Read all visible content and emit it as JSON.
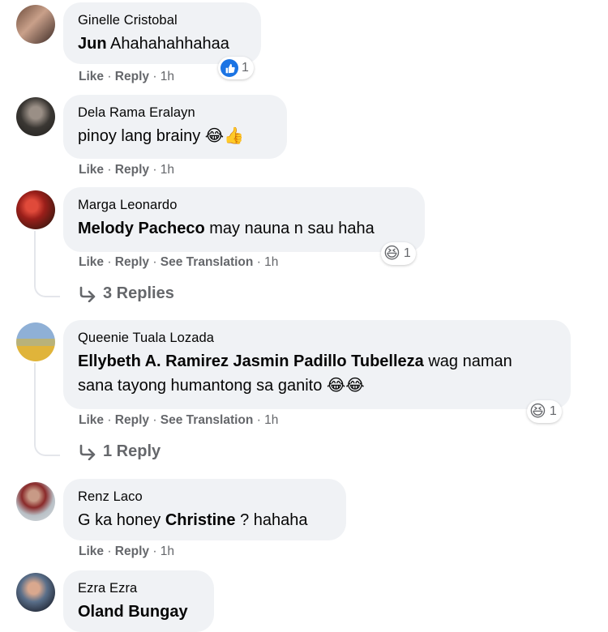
{
  "comments": [
    {
      "author": "Ginelle Cristobal",
      "text": [
        {
          "t": "Jun",
          "bold": true
        },
        {
          "t": " Ahahahahhahaa",
          "bold": false
        }
      ],
      "actions": {
        "like": "Like",
        "reply": "Reply",
        "time": "1h"
      },
      "reaction": {
        "icon": "thumbs-up-icon",
        "count": "1"
      }
    },
    {
      "author": "Dela Rama Eralayn",
      "text": [
        {
          "t": "pinoy lang brainy ",
          "bold": false
        }
      ],
      "emojis": [
        "😂",
        "👍"
      ],
      "actions": {
        "like": "Like",
        "reply": "Reply",
        "time": "1h"
      }
    },
    {
      "author": "Marga Leonardo",
      "text": [
        {
          "t": "Melody Pacheco",
          "bold": true
        },
        {
          "t": " may nauna n sau haha",
          "bold": false
        }
      ],
      "actions": {
        "like": "Like",
        "reply": "Reply",
        "see_translation": "See Translation",
        "time": "1h"
      },
      "reaction": {
        "icon": "laughing-emoji",
        "count": "1"
      },
      "replies_label": "3 Replies"
    },
    {
      "author": "Queenie Tuala Lozada",
      "text_line1": [
        {
          "t": "Ellybeth A. Ramirez Jasmin Padillo Tubelleza",
          "bold": true
        },
        {
          "t": " wag naman",
          "bold": false
        }
      ],
      "text_line2": "sana tayong humantong sa ganito ",
      "emojis": [
        "😂",
        "😂"
      ],
      "actions": {
        "like": "Like",
        "reply": "Reply",
        "see_translation": "See Translation",
        "time": "1h"
      },
      "reaction": {
        "icon": "laughing-emoji",
        "count": "1"
      },
      "replies_label": "1 Reply"
    },
    {
      "author": "Renz Laco",
      "text": [
        {
          "t": "G ka honey ",
          "bold": false
        },
        {
          "t": "Christine",
          "bold": true
        },
        {
          "t": " ? hahaha",
          "bold": false
        }
      ],
      "actions": {
        "like": "Like",
        "reply": "Reply",
        "time": "1h"
      }
    },
    {
      "author": "Ezra Ezra",
      "text": [
        {
          "t": "Oland Bungay",
          "bold": true
        }
      ]
    }
  ],
  "separator": "·",
  "colors": {
    "bubble": "#f0f2f5",
    "meta": "#65676b",
    "like_blue": "#1b74e4"
  }
}
